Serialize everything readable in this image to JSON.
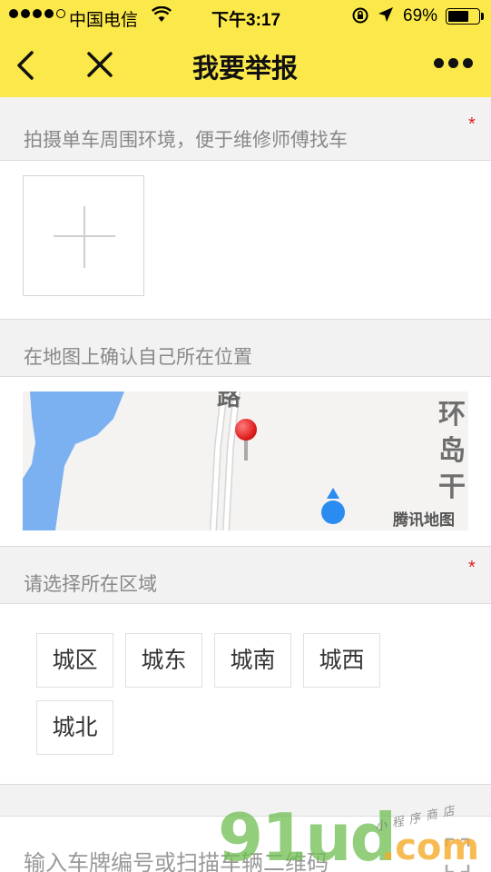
{
  "status_bar": {
    "carrier": "中国电信",
    "time": "下午3:17",
    "battery_percent": "69%",
    "battery_level": 0.69
  },
  "nav": {
    "title": "我要举报",
    "back_icon": "chevron-left-icon",
    "close_icon": "close-icon",
    "more_icon": "more-dots-icon"
  },
  "photo_section": {
    "label": "拍摄单车周围环境，便于维修师傅找车",
    "required_mark": "*"
  },
  "map_section": {
    "label": "在地图上确认自己所在位置",
    "map_fragment_top": "路",
    "map_road_label": "环岛干",
    "map_brand": "腾讯地图"
  },
  "area_section": {
    "label": "请选择所在区域",
    "required_mark": "*",
    "options": [
      "城区",
      "城东",
      "城南",
      "城西",
      "城北"
    ]
  },
  "plate_section": {
    "placeholder": "输入车牌编号或扫描车辆二维码"
  },
  "watermark": {
    "main": "91ud",
    "suffix": ".com",
    "tagline": "小程序商店"
  },
  "colors": {
    "header_bg": "#fbe84a",
    "required": "#e02020",
    "water": "#7bb1f0",
    "location_dot": "#2a8cf0",
    "pin": "#e02020"
  }
}
